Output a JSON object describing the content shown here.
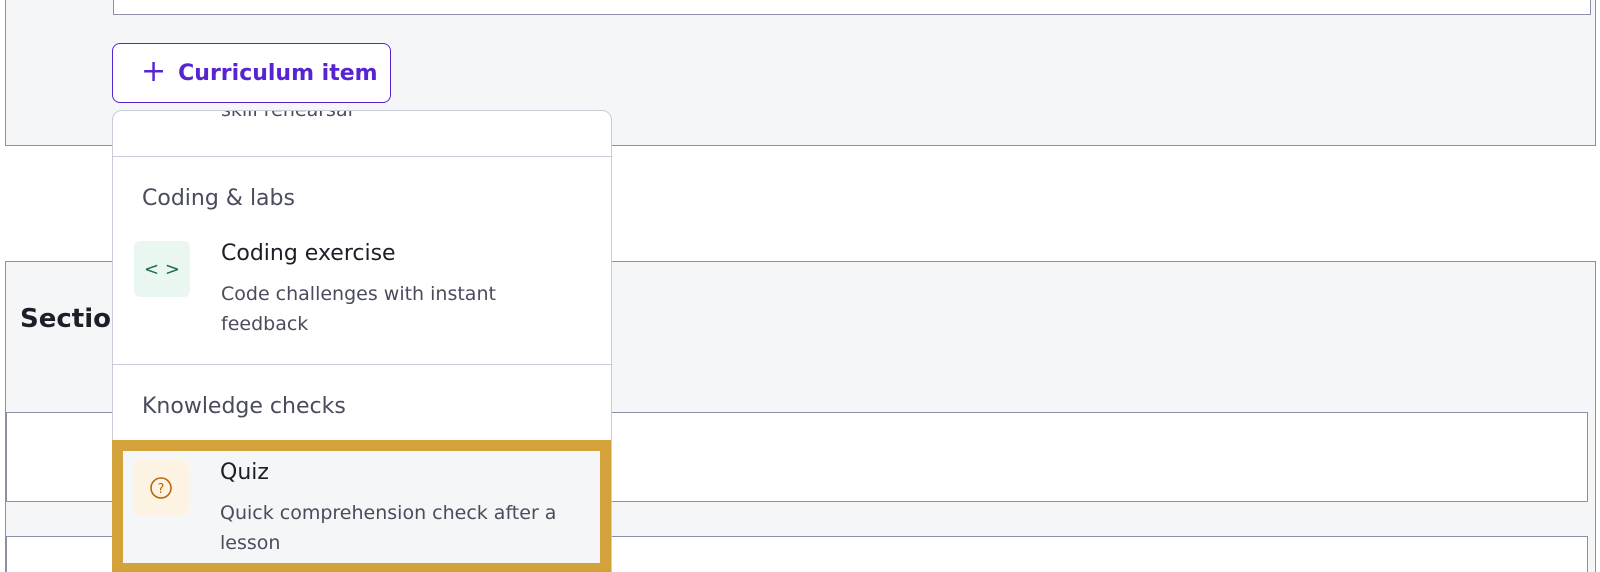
{
  "add_button": {
    "icon": "plus-icon",
    "label": "Curriculum item"
  },
  "section": {
    "title": "Sectio"
  },
  "menu": {
    "cut_text": "skill rehearsal",
    "groups": [
      {
        "title": "Coding & labs",
        "items": [
          {
            "icon": "code-brackets-icon",
            "title": "Coding exercise",
            "description": "Code challenges with instant feedback"
          }
        ]
      },
      {
        "title": "Knowledge checks",
        "items": [
          {
            "icon": "question-circle-icon",
            "title": "Quiz",
            "description": "Quick comprehension check after a lesson",
            "highlighted": true
          }
        ]
      }
    ]
  },
  "colors": {
    "accent": "#5624d0",
    "highlight": "#d4a23b"
  }
}
